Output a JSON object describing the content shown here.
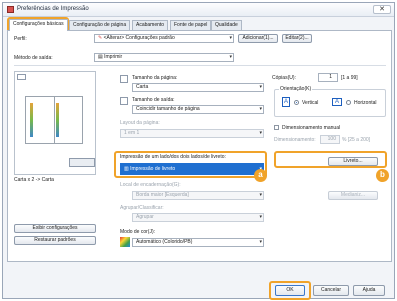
{
  "window": {
    "title": "Preferências de Impressão",
    "close": "✕"
  },
  "tabs": [
    "Configurações básicas",
    "Configuração de página",
    "Acabamento",
    "Fonte de papel",
    "Qualidade"
  ],
  "profile": {
    "label": "Perfil:",
    "value": "<Alterar> Configurações padrão",
    "add_button": "Adicionar(1)...",
    "edit_button": "Editar(2)..."
  },
  "output_method": {
    "label": "Método de saída:",
    "value": "Imprimir"
  },
  "preview": {
    "caption": "Carta x 2 -> Carta"
  },
  "left_buttons": {
    "view_settings": "Exibir configurações",
    "restore_defaults": "Restaurar padrões"
  },
  "page_size": {
    "label": "Tamanho da página:",
    "value": "Carta"
  },
  "output_size": {
    "label": "Tamanho de saída:",
    "value": "Coincidir tamanho de página"
  },
  "layout": {
    "label": "Layout da página:",
    "value": "1 em 1"
  },
  "duplex": {
    "label": "Impressão de um lado/dos dois lados/de livreto:",
    "value": "Impressão de livreto"
  },
  "binding": {
    "label": "Local de encadernação(G):",
    "value": "Borda maior [Esquerda]",
    "button": "Medianiz..."
  },
  "collate": {
    "label": "Agrupar/Classificar:",
    "value": "Agrupar"
  },
  "color_mode": {
    "label": "Modo de cor(J):",
    "value": "Automático (Colorido/PB)"
  },
  "copies": {
    "label": "Cópias(U):",
    "value": "1",
    "range": "[1 a 99]"
  },
  "orientation": {
    "label": "Orientação(K)",
    "portrait": "Vertical",
    "landscape": "Horizontal"
  },
  "manual_scaling": {
    "label": "Dimensionamento manual",
    "field_label": "Dimensionamento:",
    "value": "100",
    "range": "% [25 a 200]"
  },
  "booklet_button": "Livreto...",
  "badges": {
    "a": "a",
    "b": "b"
  },
  "footer": {
    "ok": "OK",
    "cancel": "Cancelar",
    "help": "Ajuda"
  }
}
